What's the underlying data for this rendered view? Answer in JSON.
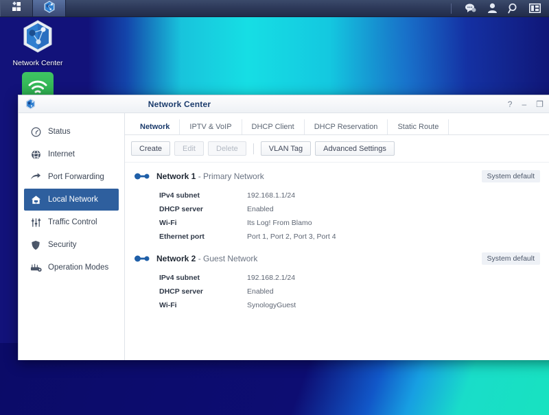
{
  "taskbar": {
    "apps": [
      {
        "name": "app-launcher",
        "icon": "grid-icon"
      },
      {
        "name": "network-center-task",
        "icon": "network-center-icon",
        "active": true
      }
    ],
    "tray": [
      {
        "name": "notifications",
        "icon": "chat-bubble-icon"
      },
      {
        "name": "user-account",
        "icon": "person-icon"
      },
      {
        "name": "search",
        "icon": "magnifier-icon"
      },
      {
        "name": "widgets",
        "icon": "panel-layout-icon"
      }
    ]
  },
  "desktop": {
    "icons": [
      {
        "label": "Network Center",
        "icon": "network-center-icon"
      },
      {
        "label": "",
        "icon": "wifi-icon"
      }
    ]
  },
  "window": {
    "title": "Network Center",
    "icon": "network-center-icon",
    "controls": {
      "help": "?",
      "minimize": "–",
      "maximize": "❐",
      "close": "✕"
    }
  },
  "sidebar": {
    "items": [
      {
        "label": "Status",
        "icon": "gauge-icon",
        "selected": false
      },
      {
        "label": "Internet",
        "icon": "globe-icon",
        "selected": false
      },
      {
        "label": "Port Forwarding",
        "icon": "arrow-forward-icon",
        "selected": false
      },
      {
        "label": "Local Network",
        "icon": "home-network-icon",
        "selected": true
      },
      {
        "label": "Traffic Control",
        "icon": "sliders-icon",
        "selected": false
      },
      {
        "label": "Security",
        "icon": "shield-icon",
        "selected": false
      },
      {
        "label": "Operation Modes",
        "icon": "router-gear-icon",
        "selected": false
      }
    ]
  },
  "tabs": [
    {
      "label": "Network",
      "active": true
    },
    {
      "label": "IPTV & VoIP",
      "active": false
    },
    {
      "label": "DHCP Client",
      "active": false
    },
    {
      "label": "DHCP Reservation",
      "active": false
    },
    {
      "label": "Static Route",
      "active": false
    }
  ],
  "toolbar": {
    "buttons": [
      {
        "label": "Create",
        "disabled": false
      },
      {
        "label": "Edit",
        "disabled": true
      },
      {
        "label": "Delete",
        "disabled": true
      },
      {
        "separator": true
      },
      {
        "label": "VLAN Tag",
        "disabled": false
      },
      {
        "label": "Advanced Settings",
        "disabled": false
      }
    ]
  },
  "networks": [
    {
      "name": "Network 1",
      "description": "- Primary Network",
      "badge": "System default",
      "collapse_icon": "chevron-up-icon",
      "rows": [
        {
          "key": "IPv4 subnet",
          "value": "192.168.1.1/24"
        },
        {
          "key": "DHCP server",
          "value": "Enabled"
        },
        {
          "key": "Wi-Fi",
          "value": "Its Log! From Blamo"
        },
        {
          "key": "Ethernet port",
          "value": "Port 1, Port 2, Port 3, Port 4"
        }
      ]
    },
    {
      "name": "Network 2",
      "description": "- Guest Network",
      "badge": "System default",
      "collapse_icon": "chevron-up-icon",
      "rows": [
        {
          "key": "IPv4 subnet",
          "value": "192.168.2.1/24"
        },
        {
          "key": "DHCP server",
          "value": "Enabled"
        },
        {
          "key": "Wi-Fi",
          "value": "SynologyGuest"
        }
      ]
    }
  ],
  "colors": {
    "accent": "#2e5f9e",
    "title_text": "#1a3a6b",
    "badge_bg": "#eef1f6",
    "wifi_tile": "#2ea94b"
  }
}
